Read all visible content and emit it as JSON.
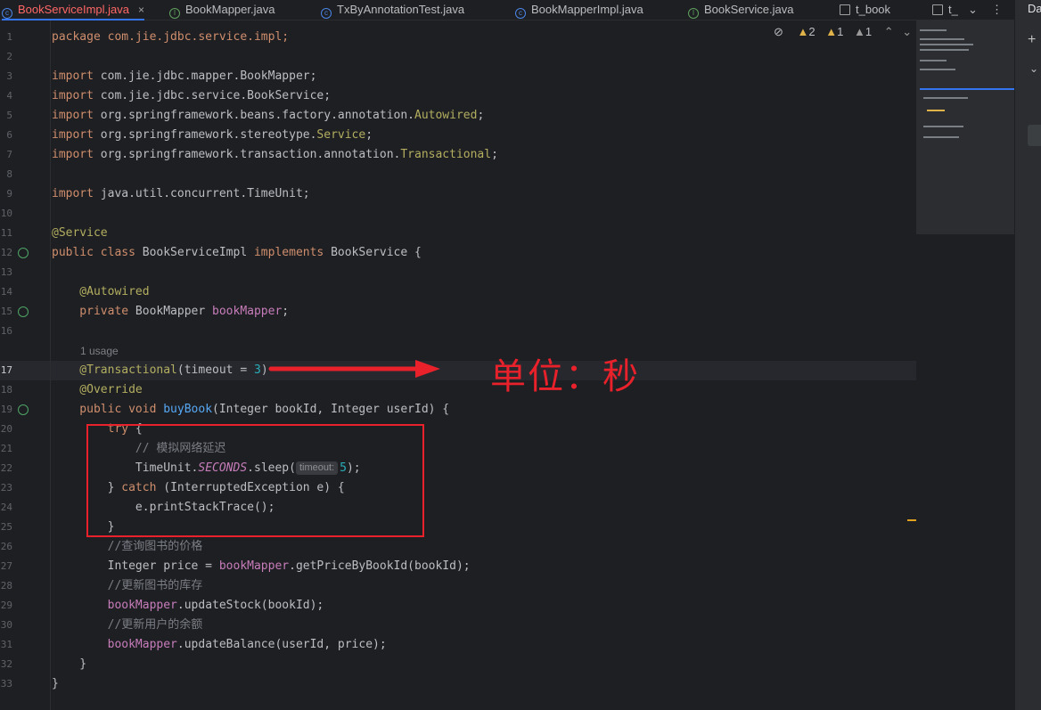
{
  "tabs": [
    {
      "label": "BookServiceImpl.java",
      "active": true,
      "icon": "class-icon"
    },
    {
      "label": "BookMapper.java",
      "icon": "interface-icon"
    },
    {
      "label": "TxByAnnotationTest.java",
      "icon": "class-icon"
    },
    {
      "label": "BookMapperImpl.java",
      "icon": "class-icon"
    },
    {
      "label": "BookService.java",
      "icon": "interface-icon"
    },
    {
      "label": "t_book",
      "icon": "table-icon"
    },
    {
      "label": "t_",
      "icon": "table-icon"
    }
  ],
  "tab_close": "×",
  "tab_more": "⌄",
  "tab_menu": "⋮",
  "right_panel": {
    "label": "Da",
    "plus": "+",
    "chevron": "⌄"
  },
  "inspections": {
    "warnings_2": "2",
    "warnings_1a": "1",
    "warnings_1b": "1"
  },
  "line_numbers": [
    "1",
    "2",
    "3",
    "4",
    "5",
    "6",
    "7",
    "8",
    "9",
    "10",
    "11",
    "12",
    "13",
    "14",
    "15",
    "16",
    "17",
    "18",
    "19",
    "20",
    "21",
    "22",
    "23",
    "24",
    "25",
    "26",
    "27",
    "28",
    "29",
    "30",
    "31",
    "32",
    "33"
  ],
  "code": {
    "l1": "package com.jie.jdbc.service.impl;",
    "l3a": "import",
    "l3b": " com.jie.jdbc.mapper.BookMapper;",
    "l4a": "import",
    "l4b": " com.jie.jdbc.service.BookService;",
    "l5a": "import",
    "l5b": " org.springframework.beans.factory.annotation.",
    "l5c": "Autowired",
    "l5d": ";",
    "l6a": "import",
    "l6b": " org.springframework.stereotype.",
    "l6c": "Service",
    "l6d": ";",
    "l7a": "import",
    "l7b": " org.springframework.transaction.annotation.",
    "l7c": "Transactional",
    "l7d": ";",
    "l9a": "import",
    "l9b": " java.util.concurrent.TimeUnit;",
    "l11": "@Service",
    "l12a": "public class",
    "l12b": " ",
    "l12c": "BookServiceImpl",
    "l12d": " implements",
    "l12e": " BookService {",
    "l14": "    @Autowired",
    "l15a": "    private",
    "l15b": " BookMapper ",
    "l15c": "bookMapper",
    "l15d": ";",
    "usage_hint": "1 usage",
    "l17a": "    @Transactional",
    "l17b": "(timeout = ",
    "l17c": "3",
    "l17d": ")",
    "l18": "    @Override",
    "l19a": "    public void",
    "l19b": " buyBook",
    "l19c": "(Integer bookId, Integer userId) {",
    "l20a": "        try",
    "l20b": " {",
    "l21": "            // 模拟网络延迟",
    "l22a": "            TimeUnit.",
    "l22b": "SECONDS",
    "l22c": ".sleep(",
    "l22hint": "timeout:",
    "l22d": "5",
    "l22e": ");",
    "l23a": "        } ",
    "l23b": "catch",
    "l23c": " (InterruptedException e) {",
    "l24": "            e.printStackTrace();",
    "l25": "        }",
    "l26": "        //查询图书的价格",
    "l27a": "        Integer price = ",
    "l27b": "bookMapper",
    "l27c": ".getPriceByBookId(bookId);",
    "l28": "        //更新图书的库存",
    "l29a": "        bookMapper",
    "l29b": ".updateStock(bookId);",
    "l30": "        //更新用户的余额",
    "l31a": "        bookMapper",
    "l31b": ".updateBalance(userId, price);",
    "l32": "    }",
    "l33": "}"
  },
  "annotation_note": "单位：秒",
  "colors": {
    "accent": "#e8212b",
    "keyword": "#cf8e6d",
    "annotation": "#b3ae60",
    "method": "#56a8f5",
    "field": "#c77dbb",
    "number": "#2aacb8"
  }
}
